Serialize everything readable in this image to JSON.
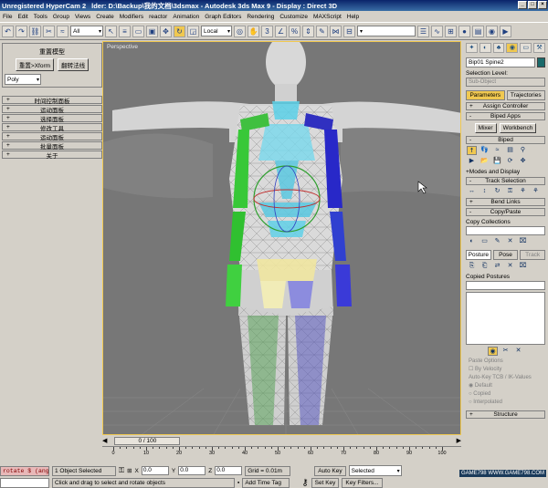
{
  "titlebar": {
    "hypercam": "Unregistered HyperCam 2",
    "title": "lder: D:\\Backup\\我的文档\\3dsmax    - Autodesk 3ds Max 9    - Display : Direct 3D"
  },
  "menu": [
    "File",
    "Edit",
    "Tools",
    "Group",
    "Views",
    "Create",
    "Modifiers",
    "reactor",
    "Animation",
    "Graph Editors",
    "Rendering",
    "Customize",
    "MAXScript",
    "Help"
  ],
  "toolbar": {
    "filter": "All",
    "refcoord": "Local"
  },
  "leftpanel": {
    "header": "重置模型",
    "btn1": "重置>Xform",
    "btn2": "翻转法线",
    "dropdown": "Poly",
    "rollouts": [
      "时间控制面板",
      "运动面板",
      "选择面板",
      "修改工具",
      "运动面板",
      "批量面板",
      "关于"
    ]
  },
  "viewport": {
    "label": "Perspective"
  },
  "rightpanel": {
    "object_name": "Bip01 Spine2",
    "selection_level": "Selection Level:",
    "sub_object": "Sub-Object",
    "tab_parameters": "Parameters",
    "tab_trajectories": "Trajectories",
    "assign_controller": "Assign Controller",
    "biped_apps": "Biped Apps",
    "mixer": "Mixer",
    "workbench": "Workbench",
    "biped": "Biped",
    "modes_display": "Modes and Display",
    "track_selection": "Track Selection",
    "bend_links": "Bend Links",
    "copy_paste": "Copy/Paste",
    "copy_collections": "Copy Collections",
    "posture": "Posture",
    "pose": "Pose",
    "track": "Track",
    "copied_postures": "Copied Postures",
    "paste_options": "Paste Options",
    "by_velocity": "By Velocity",
    "autokey_tcb": "Auto-Key TCB / IK-Values",
    "default": "Default",
    "copied": "Copied",
    "interpolated": "Interpolated",
    "structure": "Structure"
  },
  "timeslider": {
    "frame": "0 / 100"
  },
  "ruler_labels": [
    "0",
    "10",
    "20",
    "30",
    "40",
    "50",
    "60",
    "70",
    "80",
    "90",
    "100"
  ],
  "status": {
    "maxscript": "rotate $ (ang",
    "selected": "1 Object Selected",
    "prompt": "Click and drag to select and rotate objects",
    "x_label": "X",
    "x_val": "0.0",
    "y_label": "Y",
    "y_val": "0.0",
    "z_label": "Z",
    "z_val": "0.0",
    "grid": "Grid = 0.01m",
    "add_time_tag": "Add Time Tag",
    "auto_key": "Auto Key",
    "set_key": "Set Key",
    "key_sel": "Selected",
    "key_filters": "Key Filters...",
    "watermark": "GAME798  WWW.GAME798.COM"
  }
}
